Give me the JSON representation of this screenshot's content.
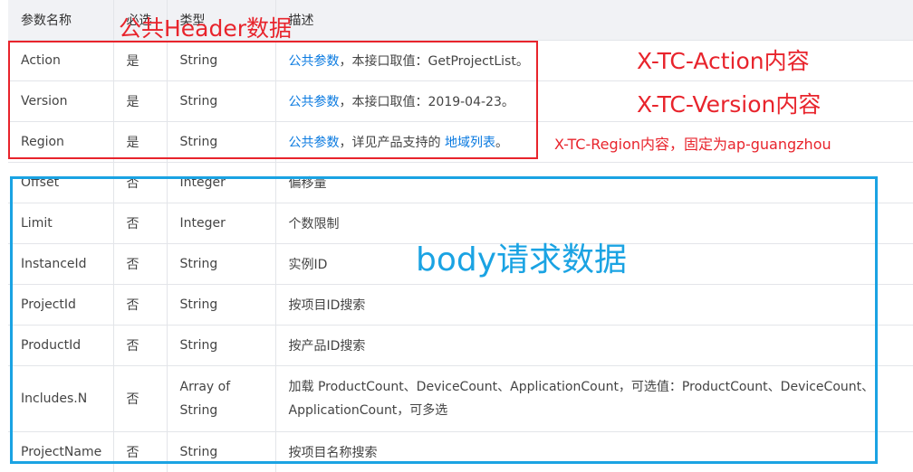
{
  "headers": [
    "参数名称",
    "必选",
    "类型",
    "描述"
  ],
  "rows": [
    {
      "name": "Action",
      "required": "是",
      "type": "String",
      "desc_link": "公共参数",
      "desc": "，本接口取值：GetProjectList。"
    },
    {
      "name": "Version",
      "required": "是",
      "type": "String",
      "desc_link": "公共参数",
      "desc": "，本接口取值：2019-04-23。"
    },
    {
      "name": "Region",
      "required": "是",
      "type": "String",
      "desc_link": "公共参数",
      "desc": "，详见产品支持的 ",
      "desc_link2": "地域列表",
      "desc_end": "。"
    },
    {
      "name": "Offset",
      "required": "否",
      "type": "Integer",
      "desc": "偏移量"
    },
    {
      "name": "Limit",
      "required": "否",
      "type": "Integer",
      "desc": "个数限制"
    },
    {
      "name": "InstanceId",
      "required": "否",
      "type": "String",
      "desc": "实例ID"
    },
    {
      "name": "ProjectId",
      "required": "否",
      "type": "String",
      "desc": "按项目ID搜索"
    },
    {
      "name": "ProductId",
      "required": "否",
      "type": "String",
      "desc": "按产品ID搜索"
    },
    {
      "name": "Includes.N",
      "required": "否",
      "type": "Array of String",
      "desc": "加载 ProductCount、DeviceCount、ApplicationCount，可选值：ProductCount、DeviceCount、ApplicationCount，可多选"
    },
    {
      "name": "ProjectName",
      "required": "否",
      "type": "String",
      "desc": "按项目名称搜索"
    }
  ],
  "annotations": {
    "header_label": "公共Header数据",
    "action_label": "X-TC-Action内容",
    "version_label": "X-TC-Version内容",
    "region_label": "X-TC-Region内容，固定为ap-guangzhou",
    "body_label": "body请求数据"
  },
  "colors": {
    "annotation_red": "#e8242c",
    "annotation_blue": "#1aa3e3",
    "link": "#0a7ae0"
  }
}
